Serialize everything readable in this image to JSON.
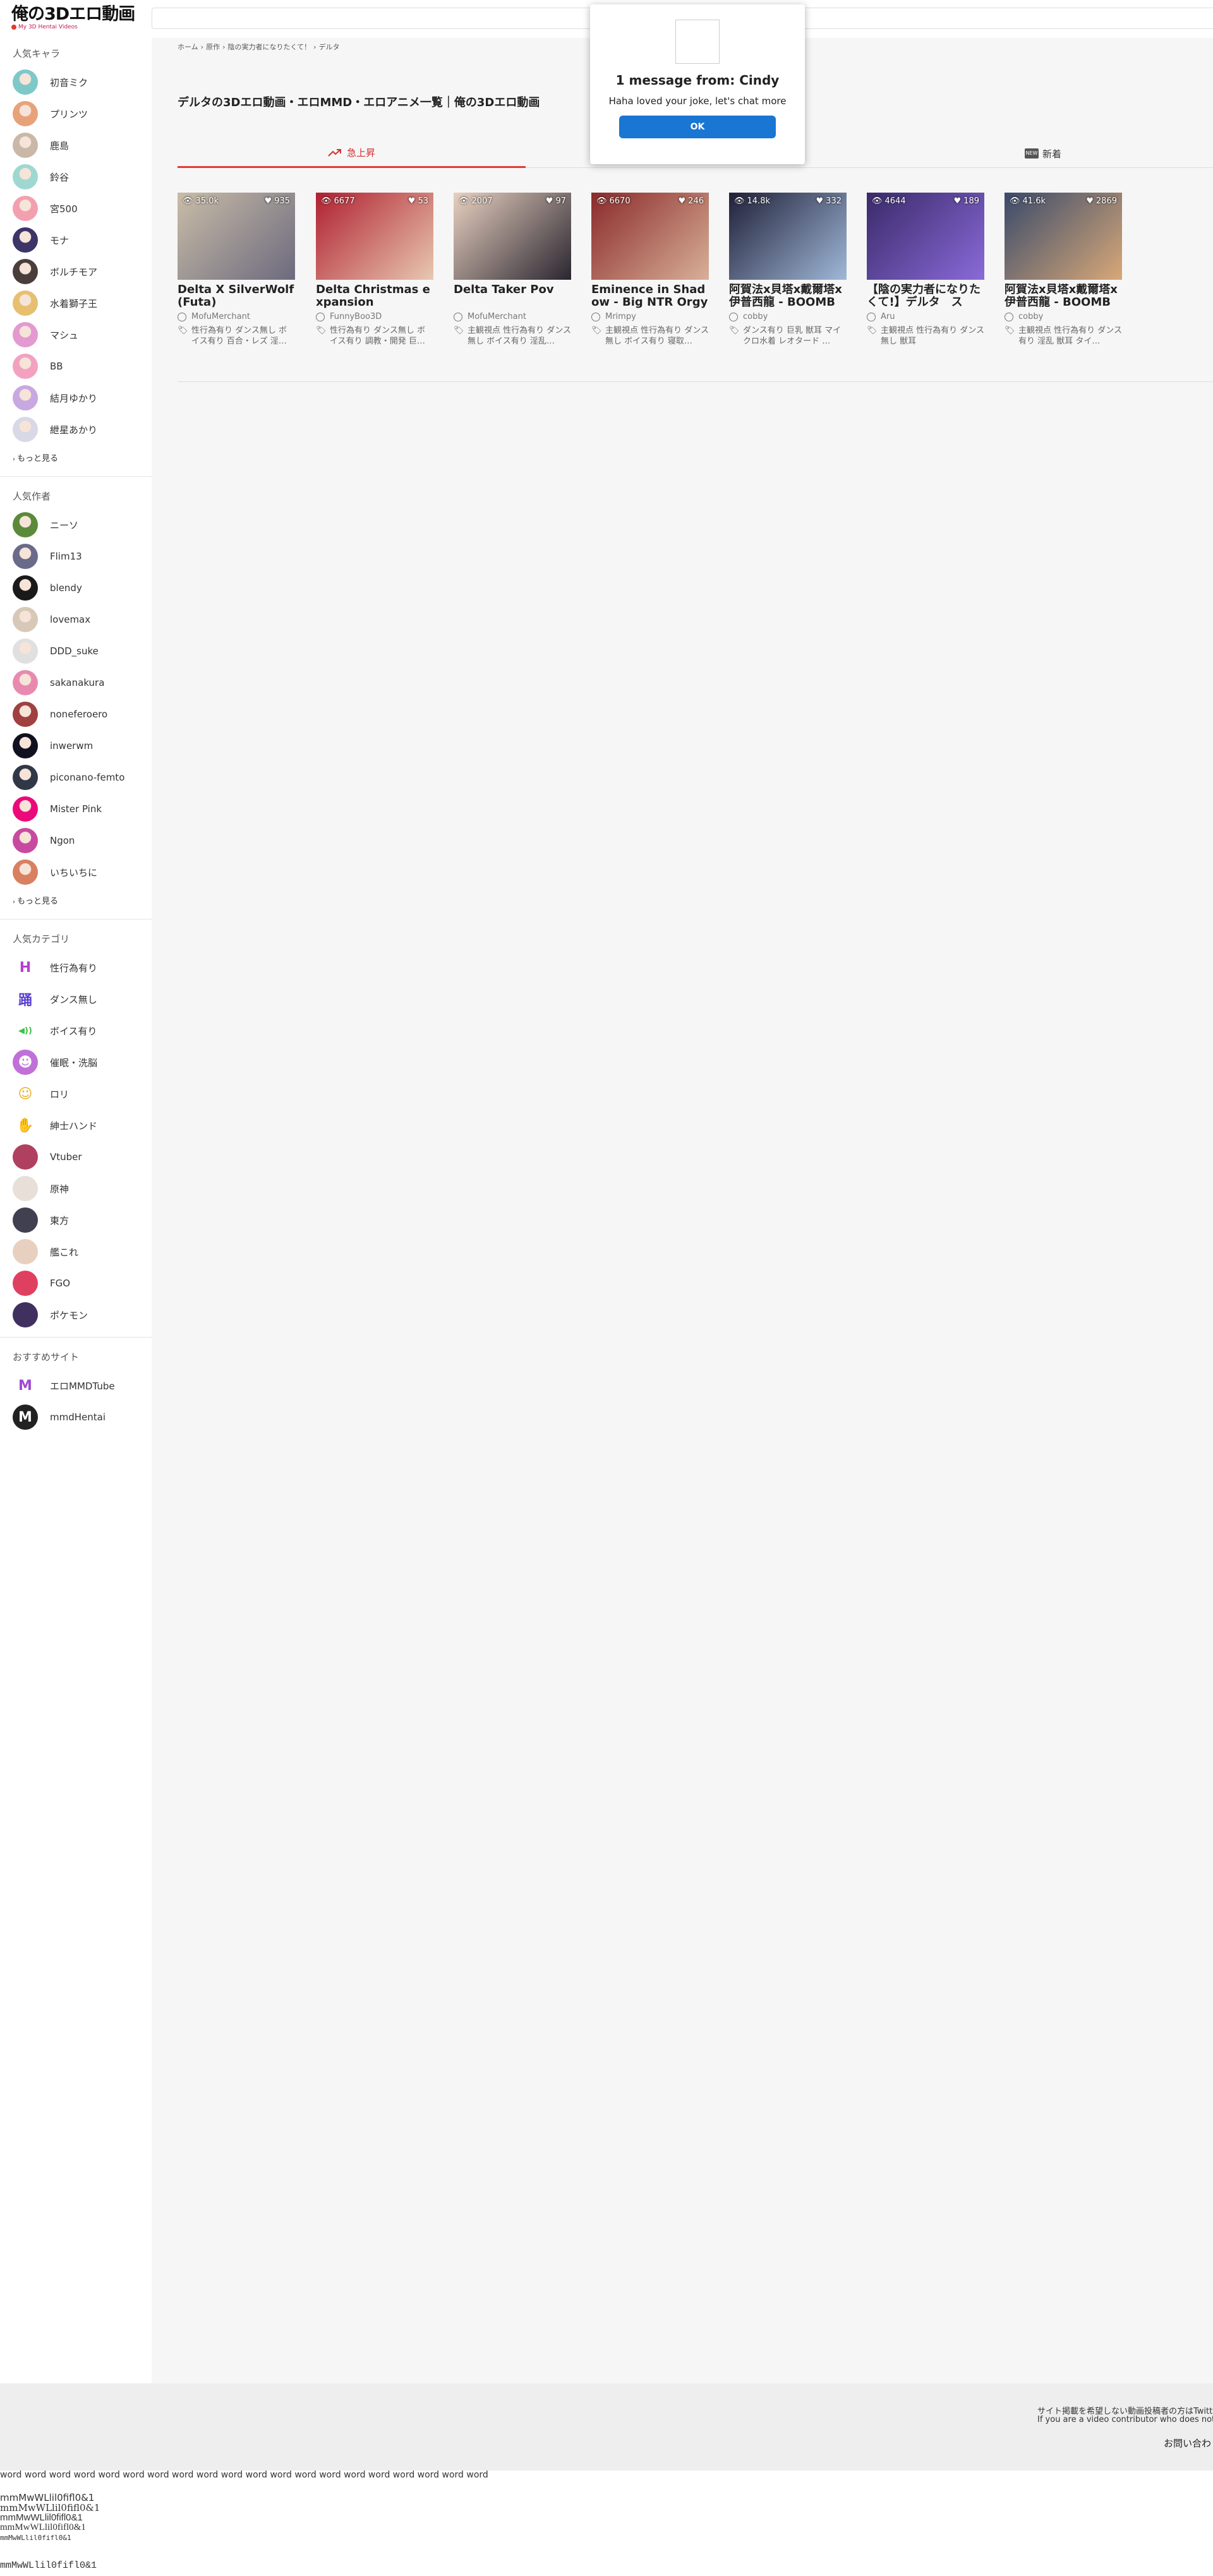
{
  "header": {
    "logo_text": "俺の3Dエロ動画",
    "logo_sub": "My 3D Hentai Videos"
  },
  "sidebar": {
    "chars_title": "人気キャラ",
    "chars": [
      {
        "label": "初音ミク",
        "color": "#7ec8c8"
      },
      {
        "label": "プリンツ",
        "color": "#e8a27a"
      },
      {
        "label": "鹿島",
        "color": "#c9b8a8"
      },
      {
        "label": "鈴谷",
        "color": "#9fd8d0"
      },
      {
        "label": "宮500",
        "color": "#f2a0b0"
      },
      {
        "label": "モナ",
        "color": "#3d3568"
      },
      {
        "label": "ボルチモア",
        "color": "#4a3e3a"
      },
      {
        "label": "水着獅子王",
        "color": "#e6c070"
      },
      {
        "label": "マシュ",
        "color": "#e39ad0"
      },
      {
        "label": "BB",
        "color": "#f2a2c0"
      },
      {
        "label": "結月ゆかり",
        "color": "#c8a8e0"
      },
      {
        "label": "紲星あかり",
        "color": "#d8d8e6"
      }
    ],
    "more1": "もっと見る",
    "authors_title": "人気作者",
    "authors": [
      {
        "label": "ニーソ",
        "color": "#5a8a3a"
      },
      {
        "label": "Flim13",
        "color": "#6a6a8a"
      },
      {
        "label": "blendy",
        "color": "#1a1a1a"
      },
      {
        "label": "lovemax",
        "color": "#d8c8b8"
      },
      {
        "label": "DDD_suke",
        "color": "#e0e0e0"
      },
      {
        "label": "sakanakura",
        "color": "#e88ab0"
      },
      {
        "label": "noneferoero",
        "color": "#a04040"
      },
      {
        "label": "inwerwm",
        "color": "#101020"
      },
      {
        "label": "piconano-femto",
        "color": "#303848"
      },
      {
        "label": "Mister Pink",
        "color": "#ec0a7a"
      },
      {
        "label": "Ngon",
        "color": "#c84aa0"
      },
      {
        "label": "いちいちに",
        "color": "#d88060"
      }
    ],
    "more2": "もっと見る",
    "cats_title": "人気カテゴリ",
    "cats": [
      {
        "label": "性行為有り",
        "color": "#ffffff",
        "fg": "#b43fd0",
        "glyph": "H"
      },
      {
        "label": "ダンス無し",
        "color": "#ffffff",
        "fg": "#5a3fd0",
        "glyph": "踊"
      },
      {
        "label": "ボイス有り",
        "color": "#ffffff",
        "fg": "#3fbf4a",
        "glyph": "◀))"
      },
      {
        "label": "催眠・洗脳",
        "color": "#c070d8",
        "fg": "#ffffff",
        "glyph": "☻"
      },
      {
        "label": "ロリ",
        "color": "#ffffff",
        "fg": "#e8b020",
        "glyph": "☺"
      },
      {
        "label": "紳士ハンド",
        "color": "#ffffff",
        "fg": "#3fcfb0",
        "glyph": "✋"
      },
      {
        "label": "Vtuber",
        "color": "#b04060",
        "fg": "#ffffff",
        "glyph": ""
      },
      {
        "label": "原神",
        "color": "#e8e0d8",
        "fg": "#ffffff",
        "glyph": ""
      },
      {
        "label": "東方",
        "color": "#404050",
        "fg": "#ffffff",
        "glyph": ""
      },
      {
        "label": "艦これ",
        "color": "#e8d0c0",
        "fg": "#ffffff",
        "glyph": ""
      },
      {
        "label": "FGO",
        "color": "#e04060",
        "fg": "#ffffff",
        "glyph": ""
      },
      {
        "label": "ポケモン",
        "color": "#403060",
        "fg": "#ffffff",
        "glyph": ""
      }
    ],
    "sites_title": "おすすめサイト",
    "sites": [
      {
        "label": "エロMMDTube",
        "color": "#ffffff",
        "fg": "#a04ad0",
        "glyph": "M"
      },
      {
        "label": "mmdHentai",
        "color": "#222222",
        "fg": "#ffffff",
        "glyph": "M"
      }
    ]
  },
  "breadcrumb": {
    "home": "ホーム",
    "orig": "原作",
    "series": "陰の実力者になりたくて！",
    "char": "デルタ",
    "sep": "›"
  },
  "page_title": "デルタの3Dエロ動画・エロMMD・エロアニメ一覧｜俺の3Dエロ動画",
  "tabs": {
    "trending": "急上昇",
    "new": "新着",
    "new_badge": "NEW"
  },
  "cards": [
    {
      "title": "Delta X SilverWolf (Futa)",
      "author": "MofuMerchant",
      "tags": "性行為有り ダンス無し ボイス有り 百合・レズ 淫…",
      "views": "35.0k",
      "likes": "935",
      "c1": "#c9bca8",
      "c2": "#6c6a7e"
    },
    {
      "title": "Delta Christmas expansion",
      "author": "FunnyBoo3D",
      "tags": "性行為有り ダンス無し ボイス有り 調教・開発 巨…",
      "views": "6677",
      "likes": "53",
      "c1": "#b02030",
      "c2": "#e8c8b0"
    },
    {
      "title": "Delta Taker Pov",
      "author": "MofuMerchant",
      "tags": "主観視点 性行為有り ダンス無し ボイス有り 淫乱…",
      "views": "2007",
      "likes": "97",
      "c1": "#e8d0c0",
      "c2": "#2a2630"
    },
    {
      "title": "Eminence in Shadow - Big NTR Orgy",
      "author": "Mrimpy",
      "tags": "主観視点 性行為有り ダンス無し ボイス有り 寝取…",
      "views": "6670",
      "likes": "246",
      "c1": "#8a2a2a",
      "c2": "#d8b098"
    },
    {
      "title": "阿賀法x貝塔x戴爾塔x伊普西龍 - BOOMBA…",
      "author": "cobby",
      "tags": "ダンス有り 巨乳 獣耳 マイクロ水着 レオタード …",
      "views": "14.8k",
      "likes": "332",
      "c1": "#202038",
      "c2": "#9fb8d8"
    },
    {
      "title": "【陰の実力者になりたくて!】デルタ　スラ…",
      "author": "Aru",
      "tags": "主観視点 性行為有り ダンス無し 獣耳",
      "views": "4644",
      "likes": "189",
      "c1": "#3a2a6a",
      "c2": "#8a6ad8"
    },
    {
      "title": "阿賀法x貝塔x戴爾塔x伊普西龍 - BOOMBA…",
      "author": "cobby",
      "tags": "主観視点 性行為有り ダンス有り 淫乱 獣耳 タイ…",
      "views": "41.6k",
      "likes": "2869",
      "c1": "#3a4a6a",
      "c2": "#d8a878"
    }
  ],
  "popup": {
    "heading": "1 message from: Cindy",
    "body": "Haha loved your joke, let's chat more",
    "ok": "OK"
  },
  "footer": {
    "line1": "サイト掲載を希望しない動画投稿者の方はTwitter",
    "line2": "If you are a video contributor who does not wi",
    "contact": "お問い合わ"
  },
  "fonttest": {
    "words": "word word word word word word word word word word word word word word word word word word word word",
    "chars": "mmMwWLlil0fifl0&1"
  }
}
